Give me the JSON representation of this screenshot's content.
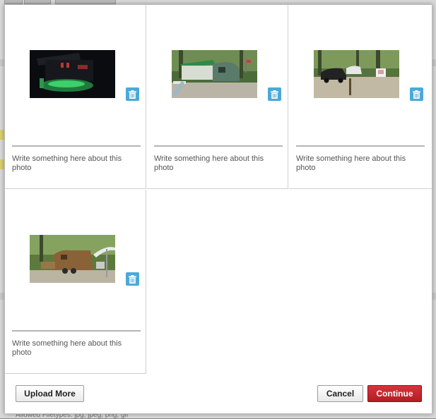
{
  "modal": {
    "photos": [
      {
        "caption": "Write something here about this photo",
        "image": "night-camper-green-lights-photo"
      },
      {
        "caption": "Write something here about this photo",
        "image": "green-teardrop-trailer-campsite-photo"
      },
      {
        "caption": "Write something here about this photo",
        "image": "cars-forest-campsite-photo"
      },
      {
        "caption": "Write something here about this photo",
        "image": "wooden-trailer-canopy-photo"
      }
    ],
    "delete_icon": "trash-icon",
    "buttons": {
      "upload_more": "Upload More",
      "cancel": "Cancel",
      "continue": "Continue"
    },
    "colors": {
      "continue_bg": "#c3222a",
      "delete_bg": "#4aa9d8"
    }
  },
  "background": {
    "allowed_filetypes": "Allowed Filetypes: jpg, jpeg, png, gif"
  }
}
